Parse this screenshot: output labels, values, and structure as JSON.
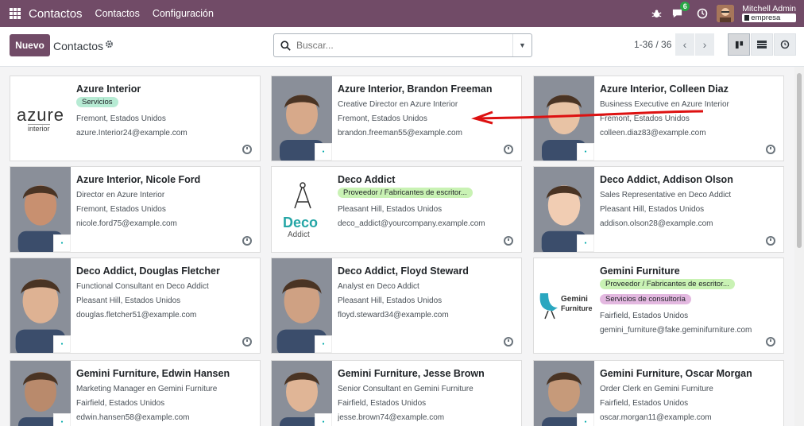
{
  "navbar": {
    "app_name": "Contactos",
    "menus": [
      "Contactos",
      "Configuración"
    ],
    "messages_badge": "6",
    "user_name": "Mitchell Admin",
    "company": "empresa"
  },
  "control": {
    "new_label": "Nuevo",
    "breadcrumb": "Contactos",
    "search_placeholder": "Buscar...",
    "pager": "1-36 / 36"
  },
  "colors": {
    "primary": "#714b67",
    "tag_green": "#b7ebd4",
    "tag_light_green": "#c9f2b4",
    "tag_purple": "#e3b8e0"
  },
  "cards": [
    {
      "title": "Azure Interior",
      "tags": [
        "Servicios"
      ],
      "lines": [
        "Fremont, Estados Unidos",
        "azure.Interior24@example.com"
      ],
      "logo": "azure"
    },
    {
      "title": "Azure Interior, Brandon Freeman",
      "tags": [],
      "lines": [
        "Creative Director en Azure Interior",
        "Fremont, Estados Unidos",
        "brandon.freeman55@example.com"
      ],
      "logo": "person"
    },
    {
      "title": "Azure Interior, Colleen Diaz",
      "tags": [],
      "lines": [
        "Business Executive en Azure Interior",
        "Fremont, Estados Unidos",
        "colleen.diaz83@example.com"
      ],
      "logo": "person"
    },
    {
      "title": "Azure Interior, Nicole Ford",
      "tags": [],
      "lines": [
        "Director en Azure Interior",
        "Fremont, Estados Unidos",
        "nicole.ford75@example.com"
      ],
      "logo": "person"
    },
    {
      "title": "Deco Addict",
      "tags": [
        "Proveedor / Fabricantes de escritor..."
      ],
      "lines": [
        "Pleasant Hill, Estados Unidos",
        "deco_addict@yourcompany.example.com"
      ],
      "logo": "deco"
    },
    {
      "title": "Deco Addict, Addison Olson",
      "tags": [],
      "lines": [
        "Sales Representative en Deco Addict",
        "Pleasant Hill, Estados Unidos",
        "addison.olson28@example.com"
      ],
      "logo": "person"
    },
    {
      "title": "Deco Addict, Douglas Fletcher",
      "tags": [],
      "lines": [
        "Functional Consultant en Deco Addict",
        "Pleasant Hill, Estados Unidos",
        "douglas.fletcher51@example.com"
      ],
      "logo": "person"
    },
    {
      "title": "Deco Addict, Floyd Steward",
      "tags": [],
      "lines": [
        "Analyst en Deco Addict",
        "Pleasant Hill, Estados Unidos",
        "floyd.steward34@example.com"
      ],
      "logo": "person"
    },
    {
      "title": "Gemini Furniture",
      "tags": [
        "Proveedor / Fabricantes de escritor...",
        "Servicios de consultoría"
      ],
      "lines": [
        "Fairfield, Estados Unidos",
        "gemini_furniture@fake.geminifurniture.com"
      ],
      "logo": "gemini"
    },
    {
      "title": "Gemini Furniture, Edwin Hansen",
      "tags": [],
      "lines": [
        "Marketing Manager en Gemini Furniture",
        "Fairfield, Estados Unidos",
        "edwin.hansen58@example.com"
      ],
      "logo": "person"
    },
    {
      "title": "Gemini Furniture, Jesse Brown",
      "tags": [],
      "lines": [
        "Senior Consultant en Gemini Furniture",
        "Fairfield, Estados Unidos",
        "jesse.brown74@example.com"
      ],
      "logo": "person"
    },
    {
      "title": "Gemini Furniture, Oscar Morgan",
      "tags": [],
      "lines": [
        "Order Clerk en Gemini Furniture",
        "Fairfield, Estados Unidos",
        "oscar.morgan11@example.com"
      ],
      "logo": "person"
    }
  ],
  "logo_text": {
    "azure": "azure",
    "azure_sub": "interior",
    "deco": "Deco",
    "deco_sub": "Addict",
    "gemini": "Gemini",
    "gemini_sub": "Furniture"
  }
}
